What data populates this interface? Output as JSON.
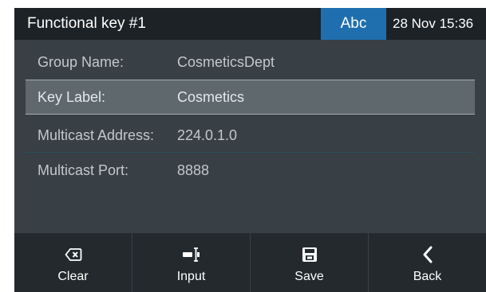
{
  "header": {
    "title": "Functional key #1",
    "input_mode": "Abc",
    "datetime": "28 Nov 15:36"
  },
  "fields": [
    {
      "label": "Group Name:",
      "value": "CosmeticsDept",
      "selected": false
    },
    {
      "label": "Key Label:",
      "value": "Cosmetics",
      "selected": true
    },
    {
      "label": "Multicast Address:",
      "value": "224.0.1.0",
      "selected": false
    },
    {
      "label": "Multicast Port:",
      "value": "8888",
      "selected": false
    }
  ],
  "softkeys": [
    {
      "label": "Clear",
      "icon": "backspace-icon"
    },
    {
      "label": "Input",
      "icon": "input-cursor-icon"
    },
    {
      "label": "Save",
      "icon": "floppy-disk-icon"
    },
    {
      "label": "Back",
      "icon": "chevron-left-icon"
    }
  ],
  "colors": {
    "background": "#383f45",
    "titlebar": "#1d2226",
    "mode_badge": "#1f6fae",
    "selected_row": "#5e686d",
    "softkey_bar": "#23292d"
  }
}
